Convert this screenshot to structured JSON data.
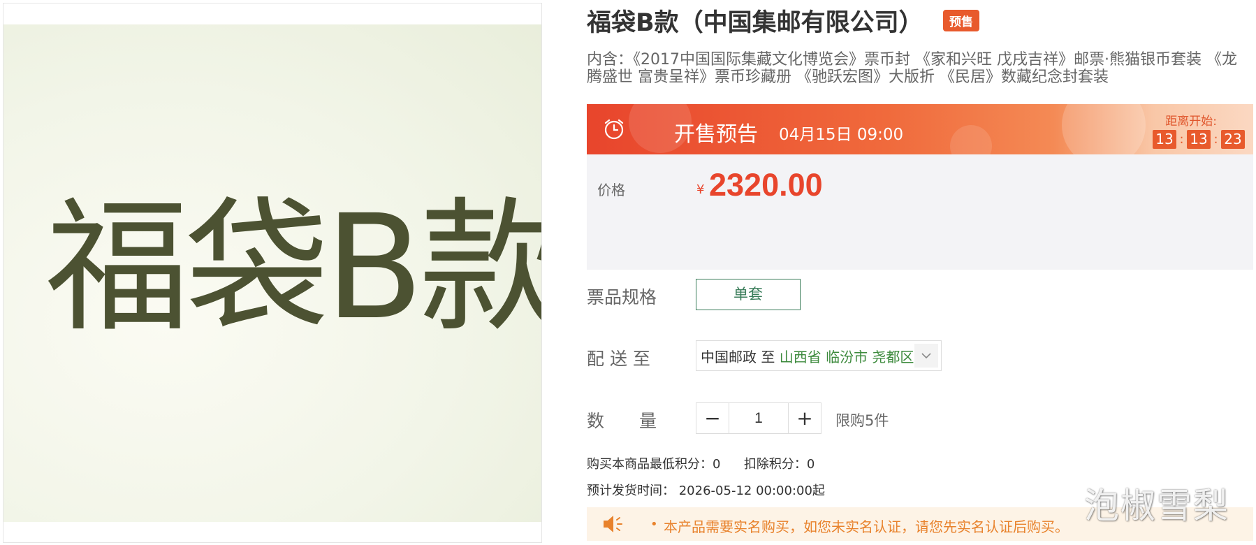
{
  "product_image": {
    "text": "福袋B款"
  },
  "title": "福袋B款（中国集邮有限公司）",
  "badge": "预售",
  "description": "内含：《2017中国国际集藏文化博览会》票币封 《家和兴旺 戊戌吉祥》邮票·熊猫银币套装 《龙腾盛世 富贵呈祥》票币珍藏册 《驰跃宏图》大版折 《民居》数藏纪念封套装",
  "banner": {
    "title": "开售预告",
    "time": "04月15日 09:00",
    "countdown_label": "距离开始:",
    "countdown": {
      "hours": "13",
      "minutes": "13",
      "seconds": "23",
      "separator": ":"
    },
    "colors": {
      "start": "#e8452c",
      "end": "#fbd8c2"
    }
  },
  "price": {
    "label": "价格",
    "currency": "¥",
    "value": "2320.00",
    "color": "#e8452c"
  },
  "spec": {
    "label": "票品规格",
    "option": "单套"
  },
  "delivery": {
    "label": "配 送 至",
    "carrier": "中国邮政",
    "to": "至",
    "region": "山西省 临汾市 尧都区"
  },
  "quantity": {
    "label": "数　　量",
    "minus": "−",
    "value": "1",
    "plus": "+",
    "limit": "限购5件"
  },
  "points": {
    "min_label": "购买本商品最低积分：",
    "min_value": "0",
    "deduct_label": "扣除积分：",
    "deduct_value": "0"
  },
  "shipping": {
    "label": "预计发货时间：",
    "value": "2026-05-12 00:00:00起"
  },
  "notice": {
    "bullet": "•",
    "text": "本产品需要实名购买，如您未实名认证，请您先实名认证后购买。"
  },
  "watermark": "泡椒雪梨",
  "icons": {
    "banner": "alarm-clock-icon",
    "notice": "speaker-icon",
    "delivery": "chevron-down-icon"
  }
}
